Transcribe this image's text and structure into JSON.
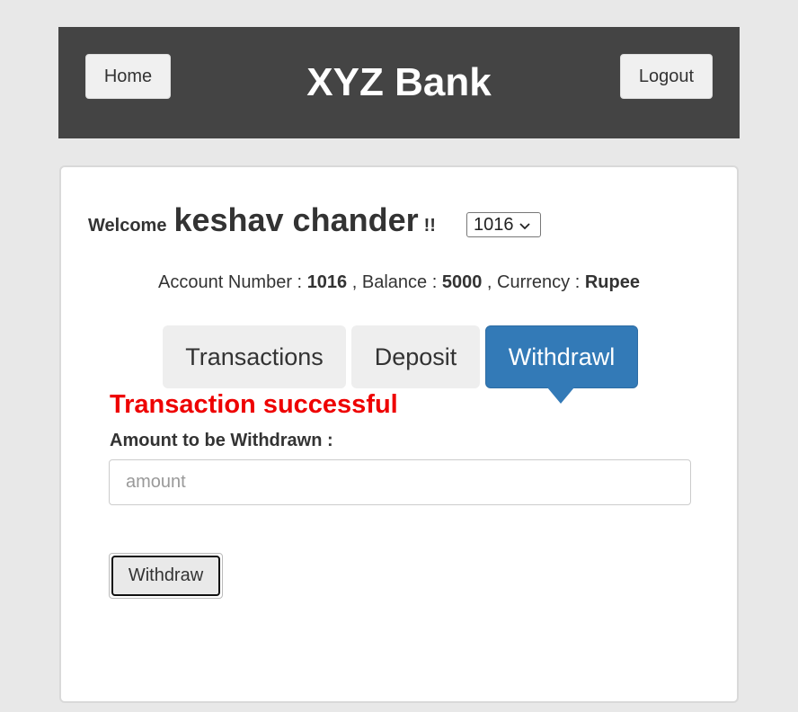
{
  "header": {
    "home_label": "Home",
    "title": "XYZ Bank",
    "logout_label": "Logout"
  },
  "welcome": {
    "label": "Welcome",
    "user_name": "keshav chander",
    "suffix": "!!"
  },
  "account_select": {
    "selected": "1016",
    "icon": "chevron-down-icon"
  },
  "account_info": {
    "account_number_label": "Account Number :",
    "account_number": "1016",
    "balance_label": ", Balance :",
    "balance": "5000",
    "currency_label": ", Currency :",
    "currency": "Rupee"
  },
  "tabs": [
    {
      "label": "Transactions",
      "active": false
    },
    {
      "label": "Deposit",
      "active": false
    },
    {
      "label": "Withdrawl",
      "active": true
    }
  ],
  "form": {
    "status_message": "Transaction successful",
    "amount_label": "Amount to be Withdrawn :",
    "amount_placeholder": "amount",
    "amount_value": "",
    "submit_label": "Withdraw"
  },
  "colors": {
    "header_bg": "#444444",
    "active_tab": "#337ab7",
    "success_text": "#ee0000",
    "page_bg": "#e8e8e8"
  }
}
